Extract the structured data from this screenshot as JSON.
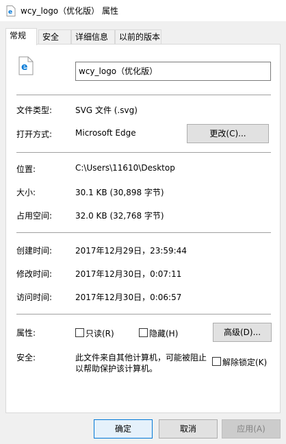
{
  "window": {
    "title": "wcy_logo（优化版） 属性"
  },
  "tabs": [
    {
      "label": "常规"
    },
    {
      "label": "安全"
    },
    {
      "label": "详细信息"
    },
    {
      "label": "以前的版本"
    }
  ],
  "general": {
    "filename": "wcy_logo（优化版）",
    "file_type_label": "文件类型:",
    "file_type_value": "SVG 文件 (.svg)",
    "open_with_label": "打开方式:",
    "open_with_value": "Microsoft Edge",
    "change_button": "更改(C)...",
    "location_label": "位置:",
    "location_value": "C:\\Users\\11610\\Desktop",
    "size_label": "大小:",
    "size_value": "30.1 KB (30,898 字节)",
    "size_on_disk_label": "占用空间:",
    "size_on_disk_value": "32.0 KB (32,768 字节)",
    "created_label": "创建时间:",
    "created_value": "2017年12月29日，23:59:44",
    "modified_label": "修改时间:",
    "modified_value": "2017年12月30日，0:07:11",
    "accessed_label": "访问时间:",
    "accessed_value": "2017年12月30日，0:06:57",
    "attributes_label": "属性:",
    "readonly_label": "只读(R)",
    "hidden_label": "隐藏(H)",
    "advanced_button": "高级(D)...",
    "security_label": "安全:",
    "security_text_line1": "此文件来自其他计算机，可能被阻止",
    "security_text_line2": "以帮助保护该计算机。",
    "unblock_label": "解除锁定(K)"
  },
  "footer": {
    "ok": "确定",
    "cancel": "取消",
    "apply": "应用(A)"
  },
  "colors": {
    "edge_blue": "#0078d7"
  }
}
